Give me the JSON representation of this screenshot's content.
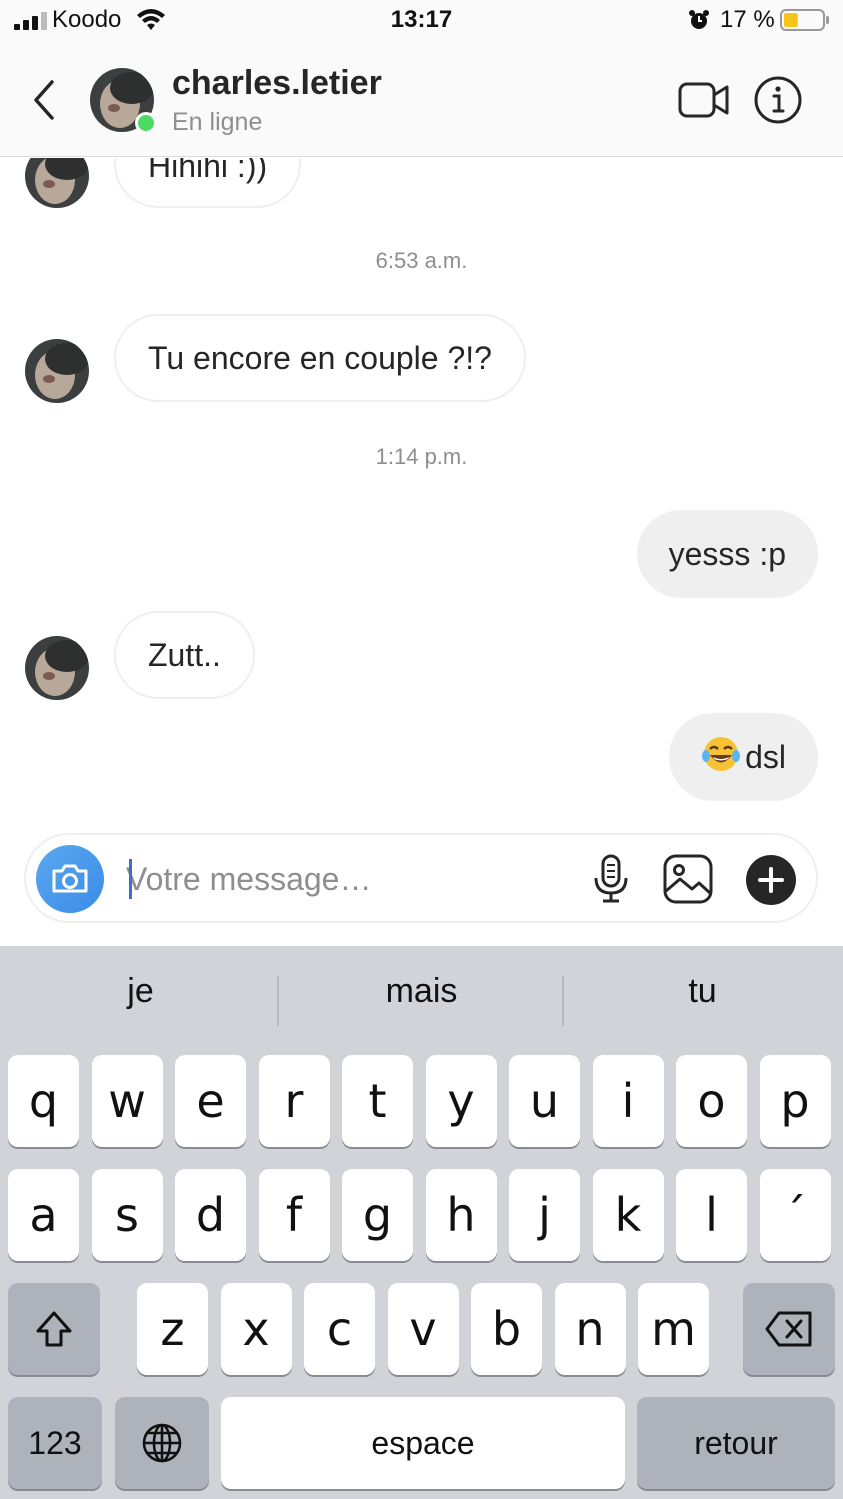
{
  "status_bar": {
    "carrier": "Koodo",
    "time": "13:17",
    "battery_percent": "17 %",
    "battery_level": 0.17,
    "icons": [
      "signal-icon",
      "wifi-icon",
      "alarm-icon",
      "battery-icon"
    ]
  },
  "header": {
    "username": "charles.letier",
    "presence": "En ligne",
    "icons": [
      "back-chevron-icon",
      "video-call-icon",
      "info-icon"
    ]
  },
  "messages": [
    {
      "type": "incoming",
      "text": "Hihihi :))"
    },
    {
      "type": "timestamp",
      "text": "6:53 a.m."
    },
    {
      "type": "incoming",
      "text": "Tu encore en couple ?!?"
    },
    {
      "type": "timestamp",
      "text": "1:14 p.m."
    },
    {
      "type": "outgoing",
      "text": "yesss :p"
    },
    {
      "type": "incoming",
      "text": "Zutt.."
    },
    {
      "type": "outgoing",
      "text": "dsl",
      "emoji": "face-with-tears-of-joy"
    }
  ],
  "composer": {
    "placeholder": "Votre message…",
    "value": "",
    "icons": [
      "camera-icon",
      "microphone-icon",
      "gallery-icon",
      "plus-icon"
    ]
  },
  "keyboard": {
    "suggestions": [
      "je",
      "mais",
      "tu"
    ],
    "row1": [
      "q",
      "w",
      "e",
      "r",
      "t",
      "y",
      "u",
      "i",
      "o",
      "p"
    ],
    "row2": [
      "a",
      "s",
      "d",
      "f",
      "g",
      "h",
      "j",
      "k",
      "l",
      "´"
    ],
    "row3": [
      "z",
      "x",
      "c",
      "v",
      "b",
      "n",
      "m"
    ],
    "numbers_label": "123",
    "space_label": "espace",
    "return_label": "retour",
    "icons": [
      "shift-icon",
      "backspace-icon",
      "globe-icon"
    ]
  },
  "colors": {
    "online": "#4cd964",
    "camera_button": "#3a8be8",
    "outgoing_bubble": "#efefef",
    "keyboard_bg": "#d1d3d9"
  }
}
